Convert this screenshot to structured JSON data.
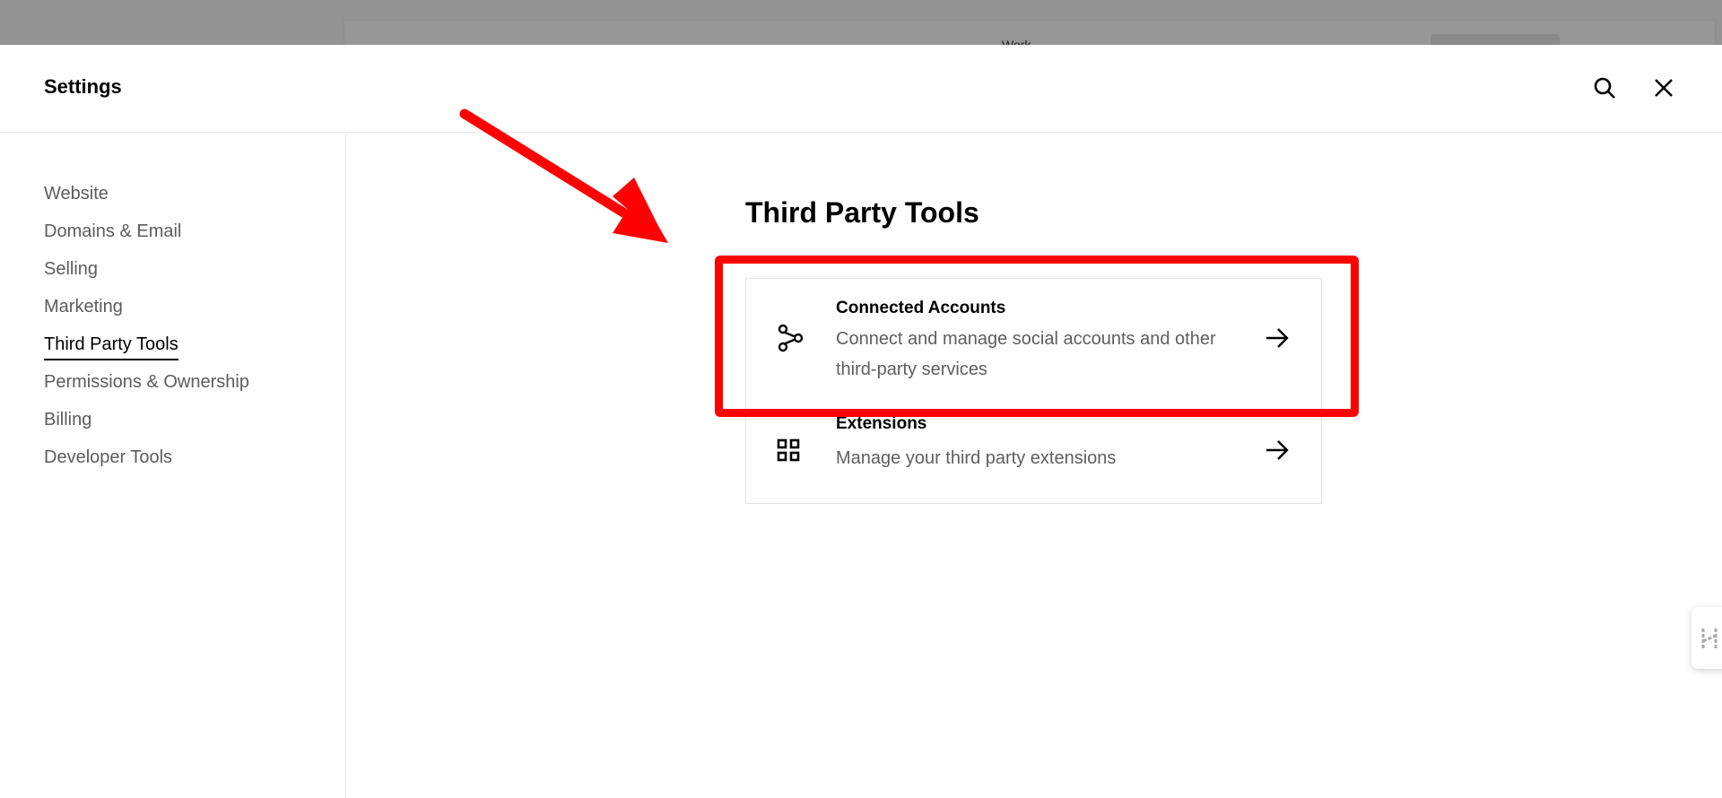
{
  "backdrop": {
    "partial_text": "Work"
  },
  "header": {
    "title": "Settings",
    "search_icon": "search-icon",
    "close_icon": "close-icon"
  },
  "sidebar": {
    "items": [
      {
        "label": "Website",
        "active": false
      },
      {
        "label": "Domains & Email",
        "active": false
      },
      {
        "label": "Selling",
        "active": false
      },
      {
        "label": "Marketing",
        "active": false
      },
      {
        "label": "Third Party Tools",
        "active": true
      },
      {
        "label": "Permissions & Ownership",
        "active": false
      },
      {
        "label": "Billing",
        "active": false
      },
      {
        "label": "Developer Tools",
        "active": false
      }
    ]
  },
  "main": {
    "heading": "Third Party Tools",
    "cards": [
      {
        "title": "Connected Accounts",
        "description": "Connect and manage social accounts and other third-party services",
        "icon": "share-nodes-icon",
        "highlighted": true
      },
      {
        "title": "Extensions",
        "description": "Manage your third party extensions",
        "icon": "grid-icon",
        "highlighted": false
      }
    ]
  },
  "annotation": {
    "color": "#ff0000",
    "type": "arrow-and-box"
  }
}
